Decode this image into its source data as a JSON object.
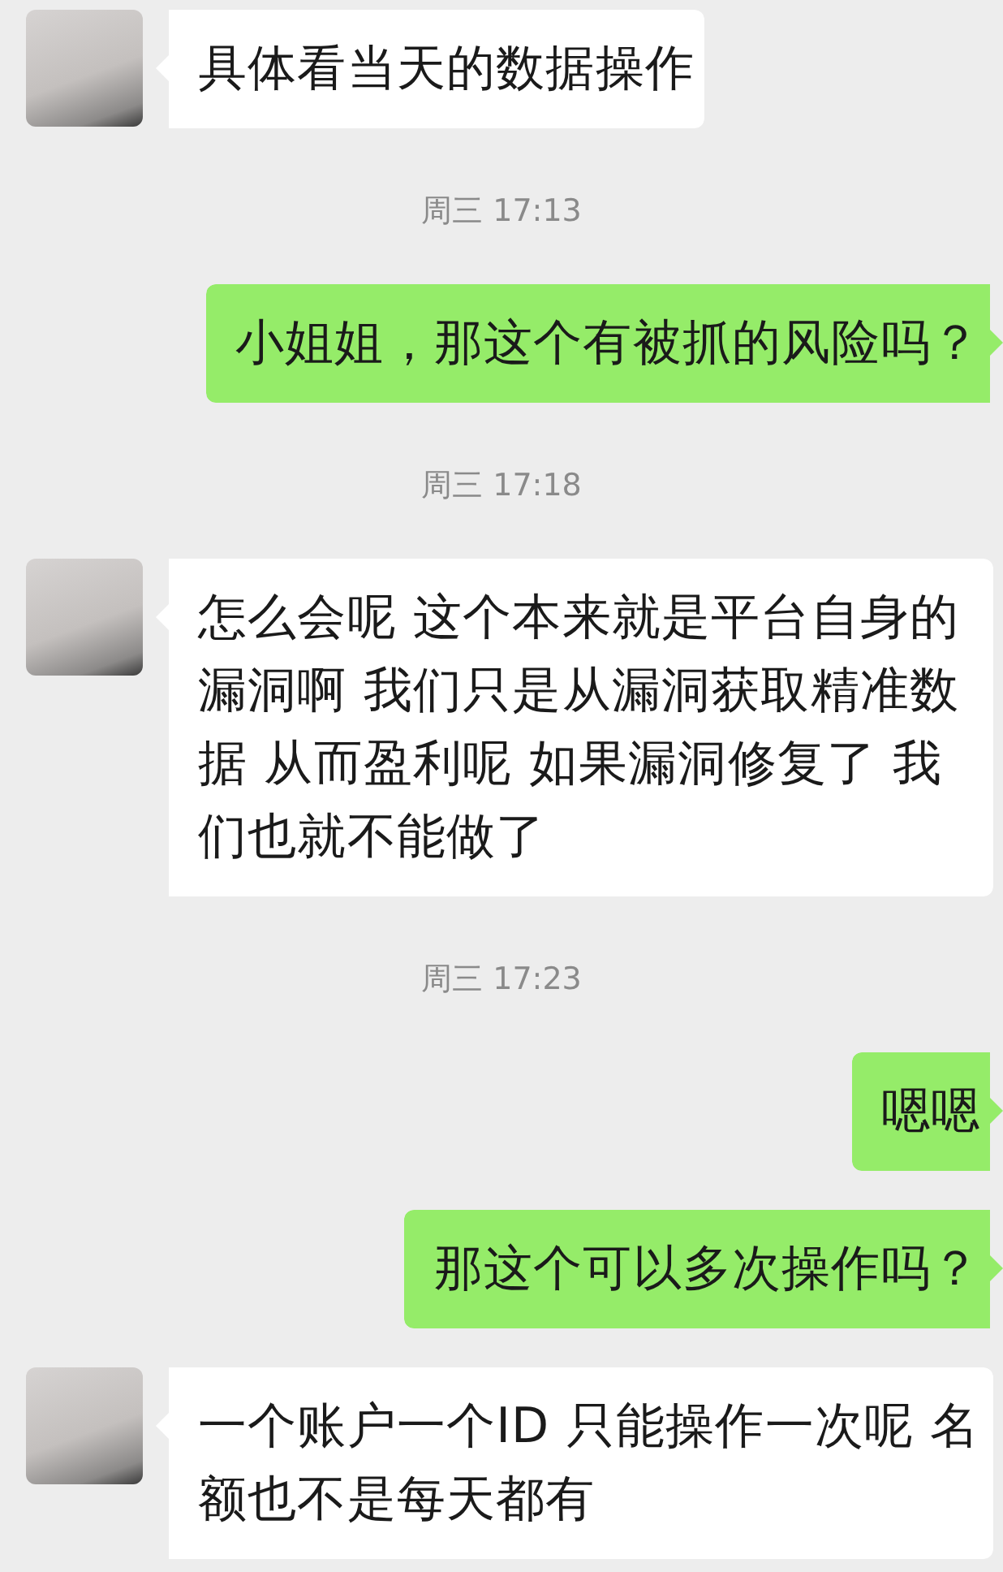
{
  "messages": [
    {
      "kind": "incoming",
      "text": "具体看当天的数据操作"
    },
    {
      "kind": "time",
      "text": "周三 17:13"
    },
    {
      "kind": "outgoing",
      "text": "小姐姐，那这个有被抓的风险吗？"
    },
    {
      "kind": "time",
      "text": "周三 17:18"
    },
    {
      "kind": "incoming",
      "text": "怎么会呢 这个本来就是平台自身的漏洞啊 我们只是从漏洞获取精准数据 从而盈利呢 如果漏洞修复了 我们也就不能做了"
    },
    {
      "kind": "time",
      "text": "周三 17:23"
    },
    {
      "kind": "outgoing",
      "text": "嗯嗯"
    },
    {
      "kind": "outgoing",
      "text": "那这个可以多次操作吗？"
    },
    {
      "kind": "incoming",
      "text": "一个账户一个ID 只能操作一次呢 名额也不是每天都有"
    }
  ]
}
